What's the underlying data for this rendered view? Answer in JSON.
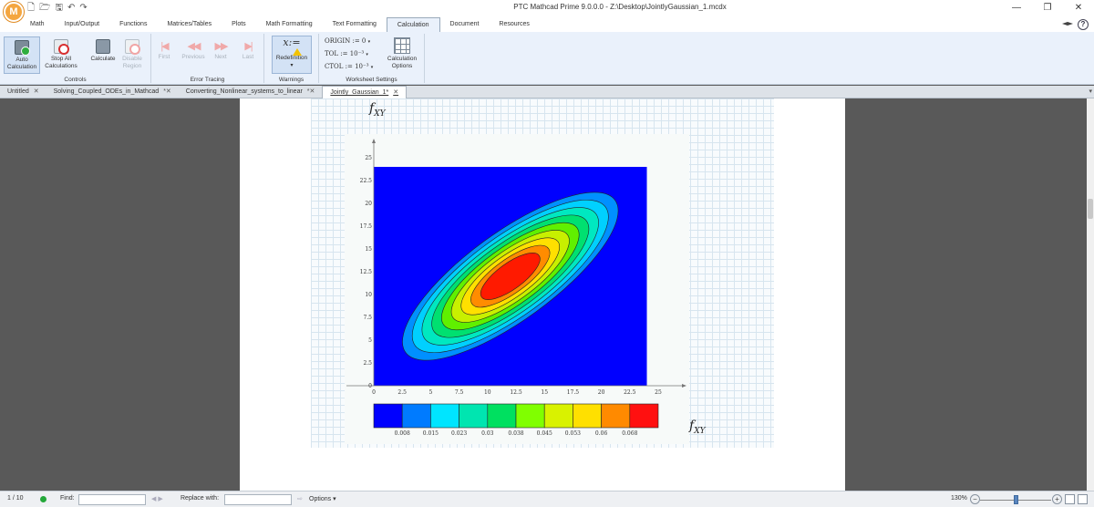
{
  "window": {
    "title": "PTC Mathcad Prime 9.0.0.0 - Z:\\Desktop\\JointlyGaussian_1.mcdx",
    "logo_letter": "M",
    "controls": {
      "minimize": "—",
      "restore": "❐",
      "close": "✕"
    }
  },
  "ribbon_tabs": [
    "Math",
    "Input/Output",
    "Functions",
    "Matrices/Tables",
    "Plots",
    "Math Formatting",
    "Text Formatting",
    "Calculation",
    "Document",
    "Resources"
  ],
  "active_ribbon_tab": "Calculation",
  "ribbon": {
    "controls": {
      "label": "Controls",
      "auto_calc_1": "Auto",
      "auto_calc_2": "Calculation",
      "stop_all_1": "Stop All",
      "stop_all_2": "Calculations",
      "calculate": "Calculate",
      "disable_1": "Disable",
      "disable_2": "Region"
    },
    "error_tracing": {
      "label": "Error Tracing",
      "first": "First",
      "previous": "Previous",
      "next": "Next",
      "last": "Last"
    },
    "warnings": {
      "label": "Warnings",
      "redefinition": "Redefinition"
    },
    "worksheet_settings": {
      "label": "Worksheet Settings",
      "origin": "ORIGIN := 0",
      "tol": "TOL := 10⁻³",
      "ctol": "CTOL := 10⁻³",
      "calc_options_1": "Calculation",
      "calc_options_2": "Options"
    }
  },
  "doc_tabs": [
    {
      "label": "Untitled",
      "close": "✕"
    },
    {
      "label": "Solving_Coupled_ODEs_in_Mathcad",
      "close": "*✕"
    },
    {
      "label": "Converting_Nonlinear_systems_to_linear",
      "close": "*✕"
    },
    {
      "label": "Jointly_Gaussian_1*",
      "close": "✕"
    }
  ],
  "worksheet": {
    "func_name": "f",
    "func_sub": "XY"
  },
  "chart_data": {
    "type": "contour",
    "title": "",
    "xlabel": "",
    "ylabel": "",
    "xlim": [
      0,
      25
    ],
    "ylim": [
      0,
      25
    ],
    "x_ticks": [
      "0",
      "2.5",
      "5",
      "7.5",
      "10",
      "12.5",
      "15",
      "17.5",
      "20",
      "22.5",
      "25"
    ],
    "y_ticks": [
      "0",
      "2.5",
      "5",
      "7.5",
      "10",
      "12.5",
      "15",
      "17.5",
      "20",
      "22.5",
      "25"
    ],
    "data_extent": {
      "x": [
        0,
        24
      ],
      "y": [
        0,
        24
      ]
    },
    "peak": {
      "x": 12,
      "y": 12
    },
    "colorbar_labels": [
      "0.008",
      "0.015",
      "0.023",
      "0.03",
      "0.038",
      "0.045",
      "0.053",
      "0.06",
      "0.068"
    ],
    "colorbar_colors": [
      "#0000ff",
      "#007bff",
      "#00e5ff",
      "#00e5b0",
      "#00e060",
      "#80ff00",
      "#d9f200",
      "#ffe000",
      "#ff8a00",
      "#ff1010"
    ],
    "contour_fill_colors": [
      "#0000ff",
      "#0090ff",
      "#00d0ff",
      "#00e8c0",
      "#00e070",
      "#60f000",
      "#c8f000",
      "#ffe000",
      "#ff8c00",
      "#ff1a00"
    ],
    "legend_label_func": "f",
    "legend_label_sub": "XY"
  },
  "status": {
    "page": "1 / 10",
    "find_label": "Find:",
    "find_value": "",
    "replace_label": "Replace with:",
    "replace_value": "",
    "options": "Options",
    "zoom": "130%"
  }
}
